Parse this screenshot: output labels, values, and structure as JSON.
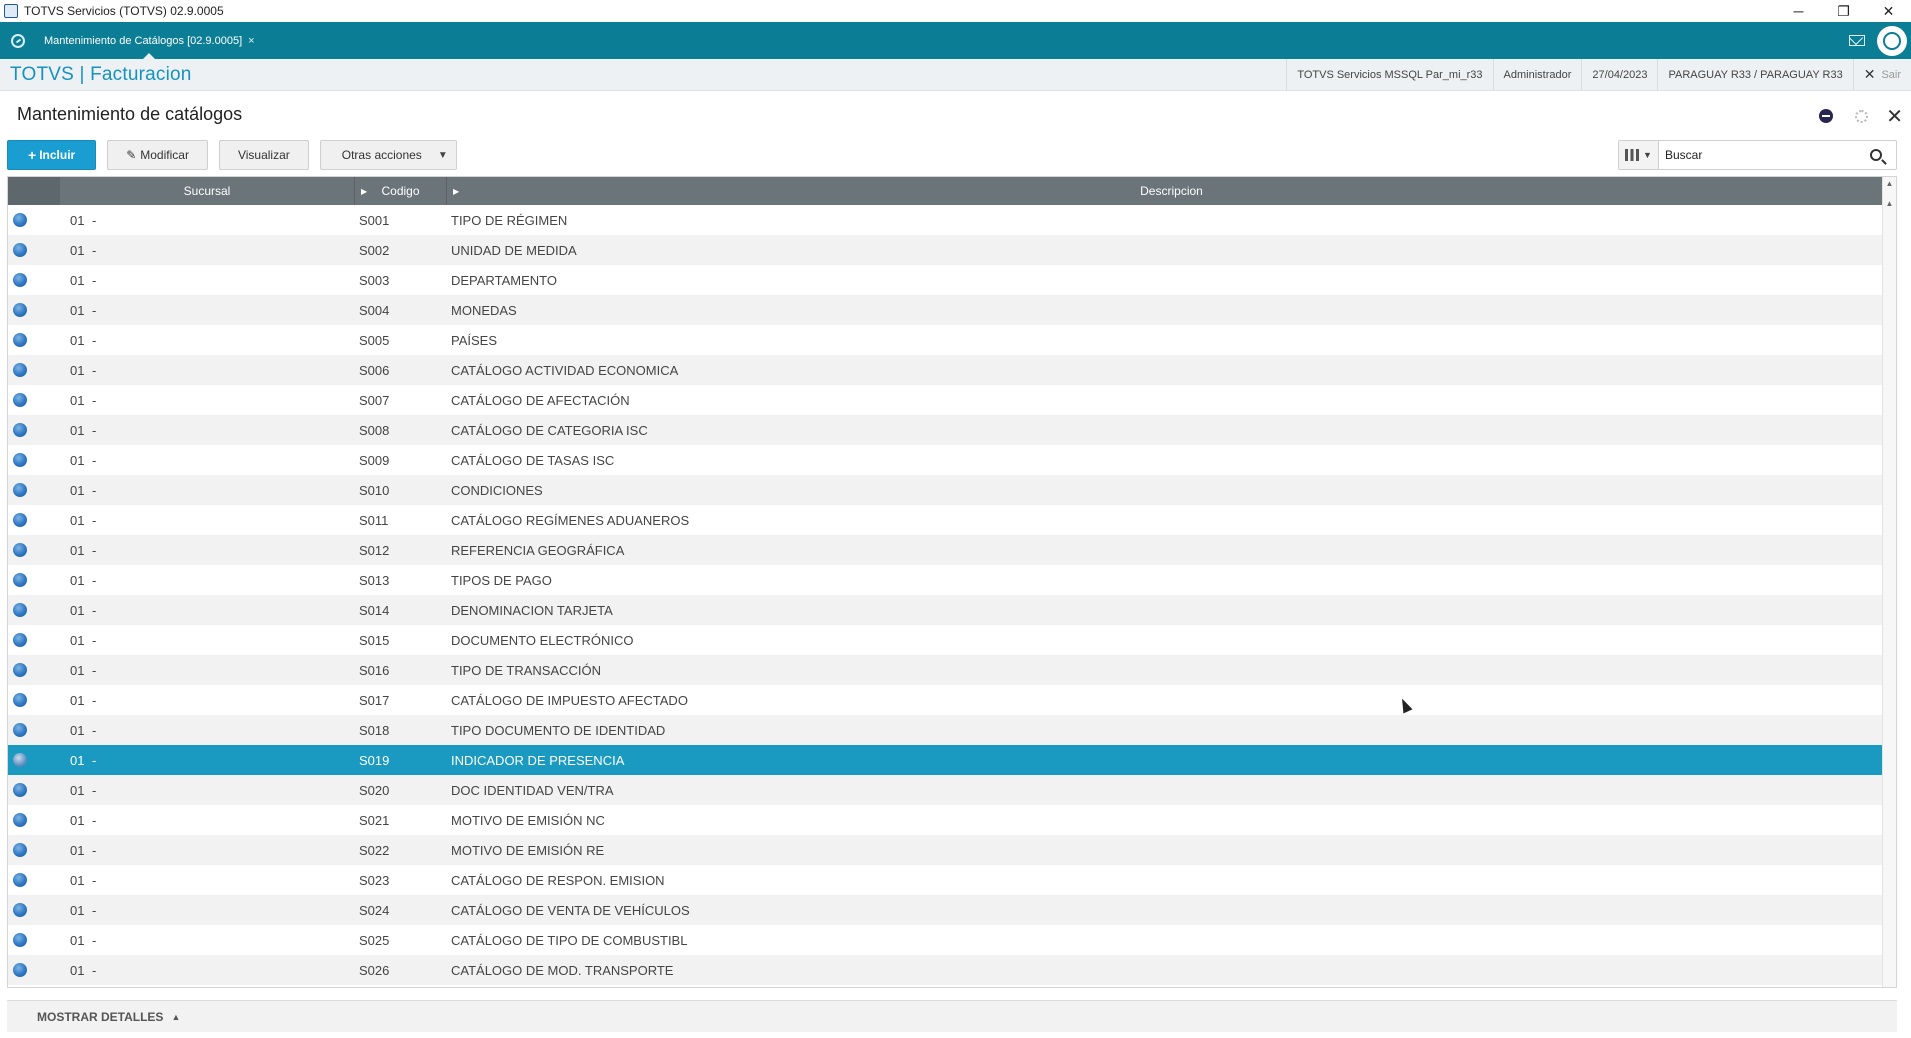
{
  "window": {
    "title": "TOTVS Servicios (TOTVS) 02.9.0005",
    "minimize": "─",
    "restore": "❐",
    "close": "✕"
  },
  "tabs": [
    {
      "label": "Mantenimiento de Catálogos [02.9.0005]",
      "close": "×"
    }
  ],
  "header": {
    "brand": "TOTVS | Facturacion",
    "environment": "TOTVS Servicios MSSQL Par_mi_r33",
    "user": "Administrador",
    "date": "27/04/2023",
    "company": "PARAGUAY R33 / PARAGUAY R33",
    "exit_label": "Sair",
    "exit_icon": "✕"
  },
  "page": {
    "title": "Mantenimiento de catálogos",
    "close": "✕"
  },
  "toolbar": {
    "include_icon": "+",
    "include_label": "Incluir",
    "modify_icon": "✎",
    "modify_label": "Modificar",
    "view_label": "Visualizar",
    "other_label": "Otras acciones",
    "other_caret": "▼"
  },
  "search": {
    "placeholder": "Buscar",
    "columns_caret": "▼"
  },
  "grid": {
    "columns": [
      "Sucursal",
      "Codigo",
      "Descripcion"
    ],
    "header_arrow": "▶",
    "rows": [
      {
        "sucursal": "01",
        "dash": "-",
        "codigo": "S001",
        "descripcion": "TIPO DE RÉGIMEN"
      },
      {
        "sucursal": "01",
        "dash": "-",
        "codigo": "S002",
        "descripcion": "UNIDAD DE MEDIDA"
      },
      {
        "sucursal": "01",
        "dash": "-",
        "codigo": "S003",
        "descripcion": "DEPARTAMENTO"
      },
      {
        "sucursal": "01",
        "dash": "-",
        "codigo": "S004",
        "descripcion": "MONEDAS"
      },
      {
        "sucursal": "01",
        "dash": "-",
        "codigo": "S005",
        "descripcion": "PAÍSES"
      },
      {
        "sucursal": "01",
        "dash": "-",
        "codigo": "S006",
        "descripcion": "CATÁLOGO ACTIVIDAD ECONOMICA"
      },
      {
        "sucursal": "01",
        "dash": "-",
        "codigo": "S007",
        "descripcion": "CATÁLOGO DE AFECTACIÓN"
      },
      {
        "sucursal": "01",
        "dash": "-",
        "codigo": "S008",
        "descripcion": "CATÁLOGO DE CATEGORIA ISC"
      },
      {
        "sucursal": "01",
        "dash": "-",
        "codigo": "S009",
        "descripcion": "CATÁLOGO DE TASAS ISC"
      },
      {
        "sucursal": "01",
        "dash": "-",
        "codigo": "S010",
        "descripcion": "CONDICIONES"
      },
      {
        "sucursal": "01",
        "dash": "-",
        "codigo": "S011",
        "descripcion": "CATÁLOGO REGÍMENES ADUANEROS"
      },
      {
        "sucursal": "01",
        "dash": "-",
        "codigo": "S012",
        "descripcion": "REFERENCIA GEOGRÁFICA"
      },
      {
        "sucursal": "01",
        "dash": "-",
        "codigo": "S013",
        "descripcion": "TIPOS DE PAGO"
      },
      {
        "sucursal": "01",
        "dash": "-",
        "codigo": "S014",
        "descripcion": "DENOMINACION TARJETA"
      },
      {
        "sucursal": "01",
        "dash": "-",
        "codigo": "S015",
        "descripcion": "DOCUMENTO ELECTRÓNICO"
      },
      {
        "sucursal": "01",
        "dash": "-",
        "codigo": "S016",
        "descripcion": "TIPO DE TRANSACCIÓN"
      },
      {
        "sucursal": "01",
        "dash": "-",
        "codigo": "S017",
        "descripcion": "CATÁLOGO DE IMPUESTO AFECTADO"
      },
      {
        "sucursal": "01",
        "dash": "-",
        "codigo": "S018",
        "descripcion": "TIPO DOCUMENTO DE IDENTIDAD"
      },
      {
        "sucursal": "01",
        "dash": "-",
        "codigo": "S019",
        "descripcion": "INDICADOR DE PRESENCIA",
        "selected": true
      },
      {
        "sucursal": "01",
        "dash": "-",
        "codigo": "S020",
        "descripcion": "DOC IDENTIDAD VEN/TRA"
      },
      {
        "sucursal": "01",
        "dash": "-",
        "codigo": "S021",
        "descripcion": "MOTIVO DE EMISIÓN NC"
      },
      {
        "sucursal": "01",
        "dash": "-",
        "codigo": "S022",
        "descripcion": "MOTIVO DE EMISIÓN RE"
      },
      {
        "sucursal": "01",
        "dash": "-",
        "codigo": "S023",
        "descripcion": "CATÁLOGO DE RESPON. EMISION"
      },
      {
        "sucursal": "01",
        "dash": "-",
        "codigo": "S024",
        "descripcion": "CATÁLOGO DE VENTA DE VEHÍCULOS"
      },
      {
        "sucursal": "01",
        "dash": "-",
        "codigo": "S025",
        "descripcion": "CATÁLOGO DE TIPO DE COMBUSTIBL"
      },
      {
        "sucursal": "01",
        "dash": "-",
        "codigo": "S026",
        "descripcion": "CATÁLOGO DE MOD. TRANSPORTE"
      }
    ]
  },
  "scrollbar": {
    "up": "▲",
    "down": "▼"
  },
  "details": {
    "label": "MOSTRAR DETALLES",
    "caret": "▲"
  },
  "colors": {
    "accent": "#1a9ed1",
    "tabbar": "#0b7d94",
    "brand": "#1592bf",
    "selected_row": "#1a9ac1",
    "grid_header": "#6b7479"
  }
}
